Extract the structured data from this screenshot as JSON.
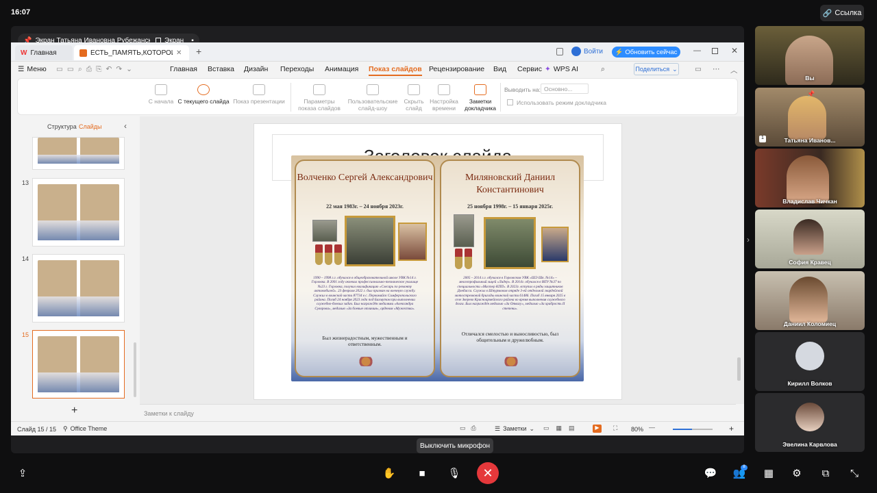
{
  "status_bar": {
    "time": "16:07"
  },
  "link_button": {
    "label": "Ссылка"
  },
  "share": {
    "presenter_label": "Экран Татьяна Ивановна Рубежанская",
    "screen_badge": "Экран"
  },
  "wps": {
    "tabs": [
      {
        "label": "Главная"
      },
      {
        "label": "ЕСТЬ_ПАМЯТЬ,КОТОРОЙ_НЕ_"
      }
    ],
    "login_label": "Войти",
    "update_button": "Обновить сейчас",
    "menu_label": "Меню",
    "ribbon_tabs": [
      "Главная",
      "Вставка",
      "Дизайн",
      "Переходы",
      "Анимация",
      "Показ слайдов",
      "Рецензирование",
      "Вид",
      "Сервис"
    ],
    "active_ribbon_tab": "Показ слайдов",
    "wps_ai": "WPS AI",
    "share_button": "Поделиться",
    "ribbon_buttons": [
      {
        "label": "С начала",
        "active": false
      },
      {
        "label": "С текущего слайда",
        "active": true
      },
      {
        "label": "Показ презентации",
        "active": false
      },
      {
        "label": "Параметры показа слайдов",
        "active": false
      },
      {
        "label": "Пользовательские слайд-шоу",
        "active": false
      },
      {
        "label": "Скрыть слайд",
        "active": false
      },
      {
        "label": "Настройка времени",
        "active": false
      },
      {
        "label": "Заметки докладчика",
        "active": true
      }
    ],
    "output_label": "Выводить на:",
    "output_value": "Основно...",
    "presenter_mode_label": "Использовать режим докладчика",
    "panel_tabs": {
      "structure": "Структура",
      "slides": "Слайды"
    },
    "thumbnails": [
      {
        "number": ""
      },
      {
        "number": "13"
      },
      {
        "number": "14"
      },
      {
        "number": "15"
      }
    ],
    "add_slide": "+",
    "slide_title_placeholder": "Заголовок слайда",
    "notes_placeholder": "Заметки к слайду",
    "status": {
      "slide_counter": "Слайд 15 / 15",
      "theme": "Office Theme",
      "notes_toggle": "Заметки",
      "zoom": "80%"
    }
  },
  "poster": {
    "left": {
      "name": "Волченко Сергей Александрович",
      "dates": "22 мая 1983г. – 24 ноября 2023г.",
      "bio": "1990 – 1998 г.г. обучался в общеобразовательной школе УВК №14 г. Горловка. В 2001 году окончил профессионально-техническое училище №23 г. Горловка, получил квалификацию «Слесарь по ремонту автомобилей». 23 февраля 2022 г. был призван на военную службу. Служил в воинской части 87734 в с. Первомайск Симферопольского района. Погиб 24 ноября 2023 года под Бахмутом при выполнении служебно-боевых задач. Был награждён медалями «Александра Суворова», медалью «За боевые отличия», орденом «Мужества».",
      "motto": "Был жизнерадостным, мужественным и ответственным."
    },
    "right": {
      "name": "Миляновский Даниил Константинович",
      "dates": "25 ноября 1998г. – 15 января 2025г.",
      "bio": "2005 – 2014 г.г. обучался в Горловском УВК «ШЭ Шк. №14» – многопрофильный лицей «Лидер». В 2014г. обучался в ВПУ №37 по специальности «Мастер КПП». В 2023г. вступил в ряды защитников Донбасса. Служил в Штурмовом отряде 3-ей отдельной гвардейской мотострелковой бригады воинской части 61486. Погиб 15 января 2025 в селе Зверево Красноармейского района во время выполнения служебного долга. Был награждён медалью «За Отвагу», медалью «За храбрость II степени».",
      "motto": "Отличался смелостью и выносливостью, был общительным и дружелюбным."
    }
  },
  "participants": [
    {
      "name": "Вы"
    },
    {
      "name": "Татьяна Иванов...",
      "badge": "1"
    },
    {
      "name": "Владислав Чичкан"
    },
    {
      "name": "София Кравец"
    },
    {
      "name": "Даниил Коломиец"
    },
    {
      "name": "Кирилл Волков"
    },
    {
      "name": "Эвелина Карвлова"
    }
  ],
  "controls": {
    "tooltip": "Выключить микрофон",
    "participants_count": "8"
  },
  "colors": {
    "accent": "#e46b1f",
    "end_call": "#e5383b",
    "update_button": "#2d8cff"
  }
}
